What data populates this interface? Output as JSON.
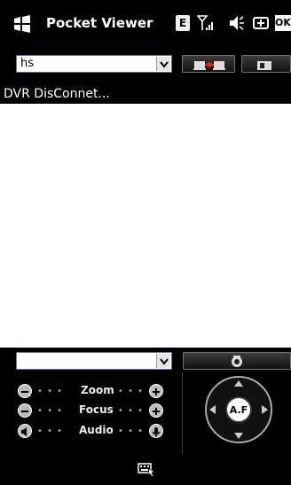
{
  "app": {
    "title": "Pocket Viewer"
  },
  "status_bar": {
    "network_badge": "E",
    "icons": [
      "windows-logo-icon",
      "signal-icon",
      "speaker-icon",
      "battery-charge-icon"
    ]
  },
  "toolbar": {
    "device_select_value": "hs",
    "connect_button_icon": "connect-icon",
    "camera_button_icon": "camera-icon"
  },
  "status": {
    "text": "DVR DisConnet..."
  },
  "controls": {
    "channel_select_value": "",
    "zoom_label": "Zoom",
    "focus_label": "Focus",
    "audio_label": "Audio",
    "af_label": "A.F",
    "dots": "• • •"
  },
  "bottom_bar": {
    "icon": "keyboard-icon"
  },
  "colors": {
    "background": "#000000",
    "video_area": "#ffffff",
    "combo_border": "#5a78a8"
  }
}
